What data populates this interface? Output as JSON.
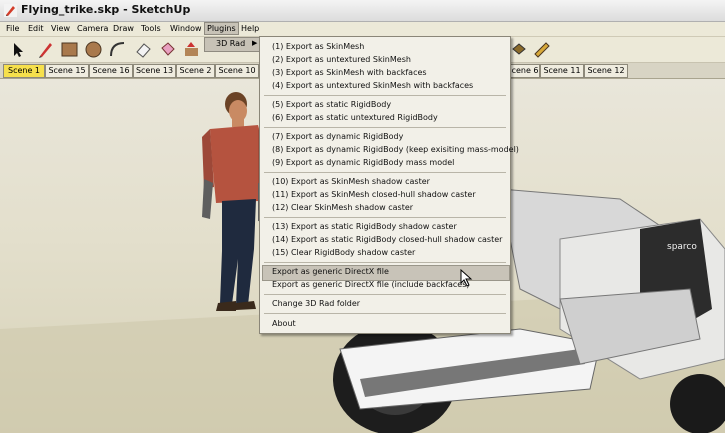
{
  "window": {
    "title": "Flying_trike.skp - SketchUp"
  },
  "menubar": {
    "items": [
      "File",
      "Edit",
      "View",
      "Camera",
      "Draw",
      "Tools",
      "Window",
      "Plugins",
      "Help"
    ]
  },
  "scene_tabs": {
    "active": "Scene 1",
    "left": [
      "Scene 1",
      "Scene 15",
      "Scene 16",
      "Scene 13",
      "Scene 2",
      "Scene 10"
    ],
    "right": [
      "Scene 6",
      "Scene 11",
      "Scene 12"
    ]
  },
  "plugins_submenu": {
    "label": "3D Rad"
  },
  "dropdown": {
    "groups": [
      [
        "(1) Export as SkinMesh",
        "(2) Export as untextured SkinMesh",
        "(3) Export as SkinMesh with backfaces",
        "(4) Export as untextured SkinMesh with backfaces"
      ],
      [
        "(5) Export as static RigidBody",
        "(6) Export as static untextured RigidBody"
      ],
      [
        "(7) Export as dynamic RigidBody",
        "(8) Export as dynamic RigidBody (keep exisiting mass-model)",
        "(9) Export as dynamic RigidBody mass model"
      ],
      [
        "(10) Export as SkinMesh shadow caster",
        "(11) Export as SkinMesh closed-hull shadow caster",
        "(12) Clear SkinMesh shadow caster"
      ],
      [
        "(13) Export as static RigidBody shadow caster",
        "(14) Export as static RigidBody closed-hull shadow caster",
        "(15) Clear RigidBody shadow caster"
      ],
      [
        "Export as generic DirectX file",
        "Export as generic DirectX file (include backfaces)"
      ],
      [
        "Change 3D Rad folder"
      ],
      [
        "About"
      ]
    ],
    "highlighted": "Export as generic DirectX file"
  },
  "scene": {
    "seat_brand": "sparco"
  },
  "colors": {
    "active_tab": "#f6e04c",
    "menu_bg": "#f2f0e8",
    "shirt": "#b5533f"
  }
}
